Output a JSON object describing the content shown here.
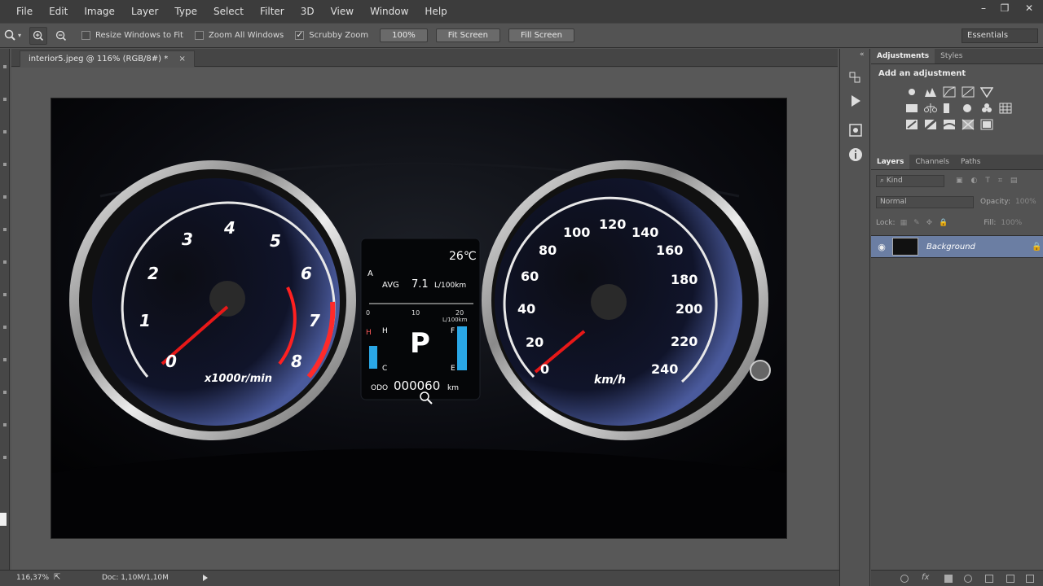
{
  "menu": [
    "File",
    "Edit",
    "Image",
    "Layer",
    "Type",
    "Select",
    "Filter",
    "3D",
    "View",
    "Window",
    "Help"
  ],
  "options": {
    "resize_windows": "Resize Windows to Fit",
    "zoom_all": "Zoom All Windows",
    "scrubby_zoom": "Scrubby Zoom",
    "btn_100": "100%",
    "btn_fit": "Fit Screen",
    "btn_fill": "Fill Screen",
    "workspace": "Essentials"
  },
  "document": {
    "tab_title": "interior5.jpeg @ 116% (RGB/8#) *",
    "tab_close": "×"
  },
  "dashboard": {
    "tach_numbers": [
      "0",
      "1",
      "2",
      "3",
      "4",
      "5",
      "6",
      "7",
      "8"
    ],
    "tach_unit": "x1000r/min",
    "speed_numbers": [
      "0",
      "20",
      "40",
      "60",
      "80",
      "100",
      "120",
      "140",
      "160",
      "180",
      "200",
      "220",
      "240"
    ],
    "speed_unit": "km/h",
    "temp": "26℃",
    "avg_label": "AVG",
    "avg_value": "7.1",
    "avg_unit": "L/100km",
    "scale": [
      "0",
      "10",
      "20"
    ],
    "scale_unit": "L/100km",
    "gear": "P",
    "odo_label": "ODO",
    "odo_value": "000060",
    "odo_unit": "km",
    "h": "H",
    "c": "C",
    "f": "F",
    "e": "E",
    "a": "A"
  },
  "status": {
    "zoom": "116,37%",
    "doc": "Doc: 1,10M/1,10M"
  },
  "panel": {
    "tabs_top": [
      "Adjustments",
      "Styles"
    ],
    "adj_title": "Add an adjustment",
    "tabs_layers": [
      "Layers",
      "Channels",
      "Paths"
    ],
    "kind": "Kind",
    "blend": "Normal",
    "opacity_label": "Opacity:",
    "opacity_value": "100%",
    "lock_label": "Lock:",
    "fill_label": "Fill:",
    "fill_value": "100%",
    "layer_name": "Background"
  }
}
